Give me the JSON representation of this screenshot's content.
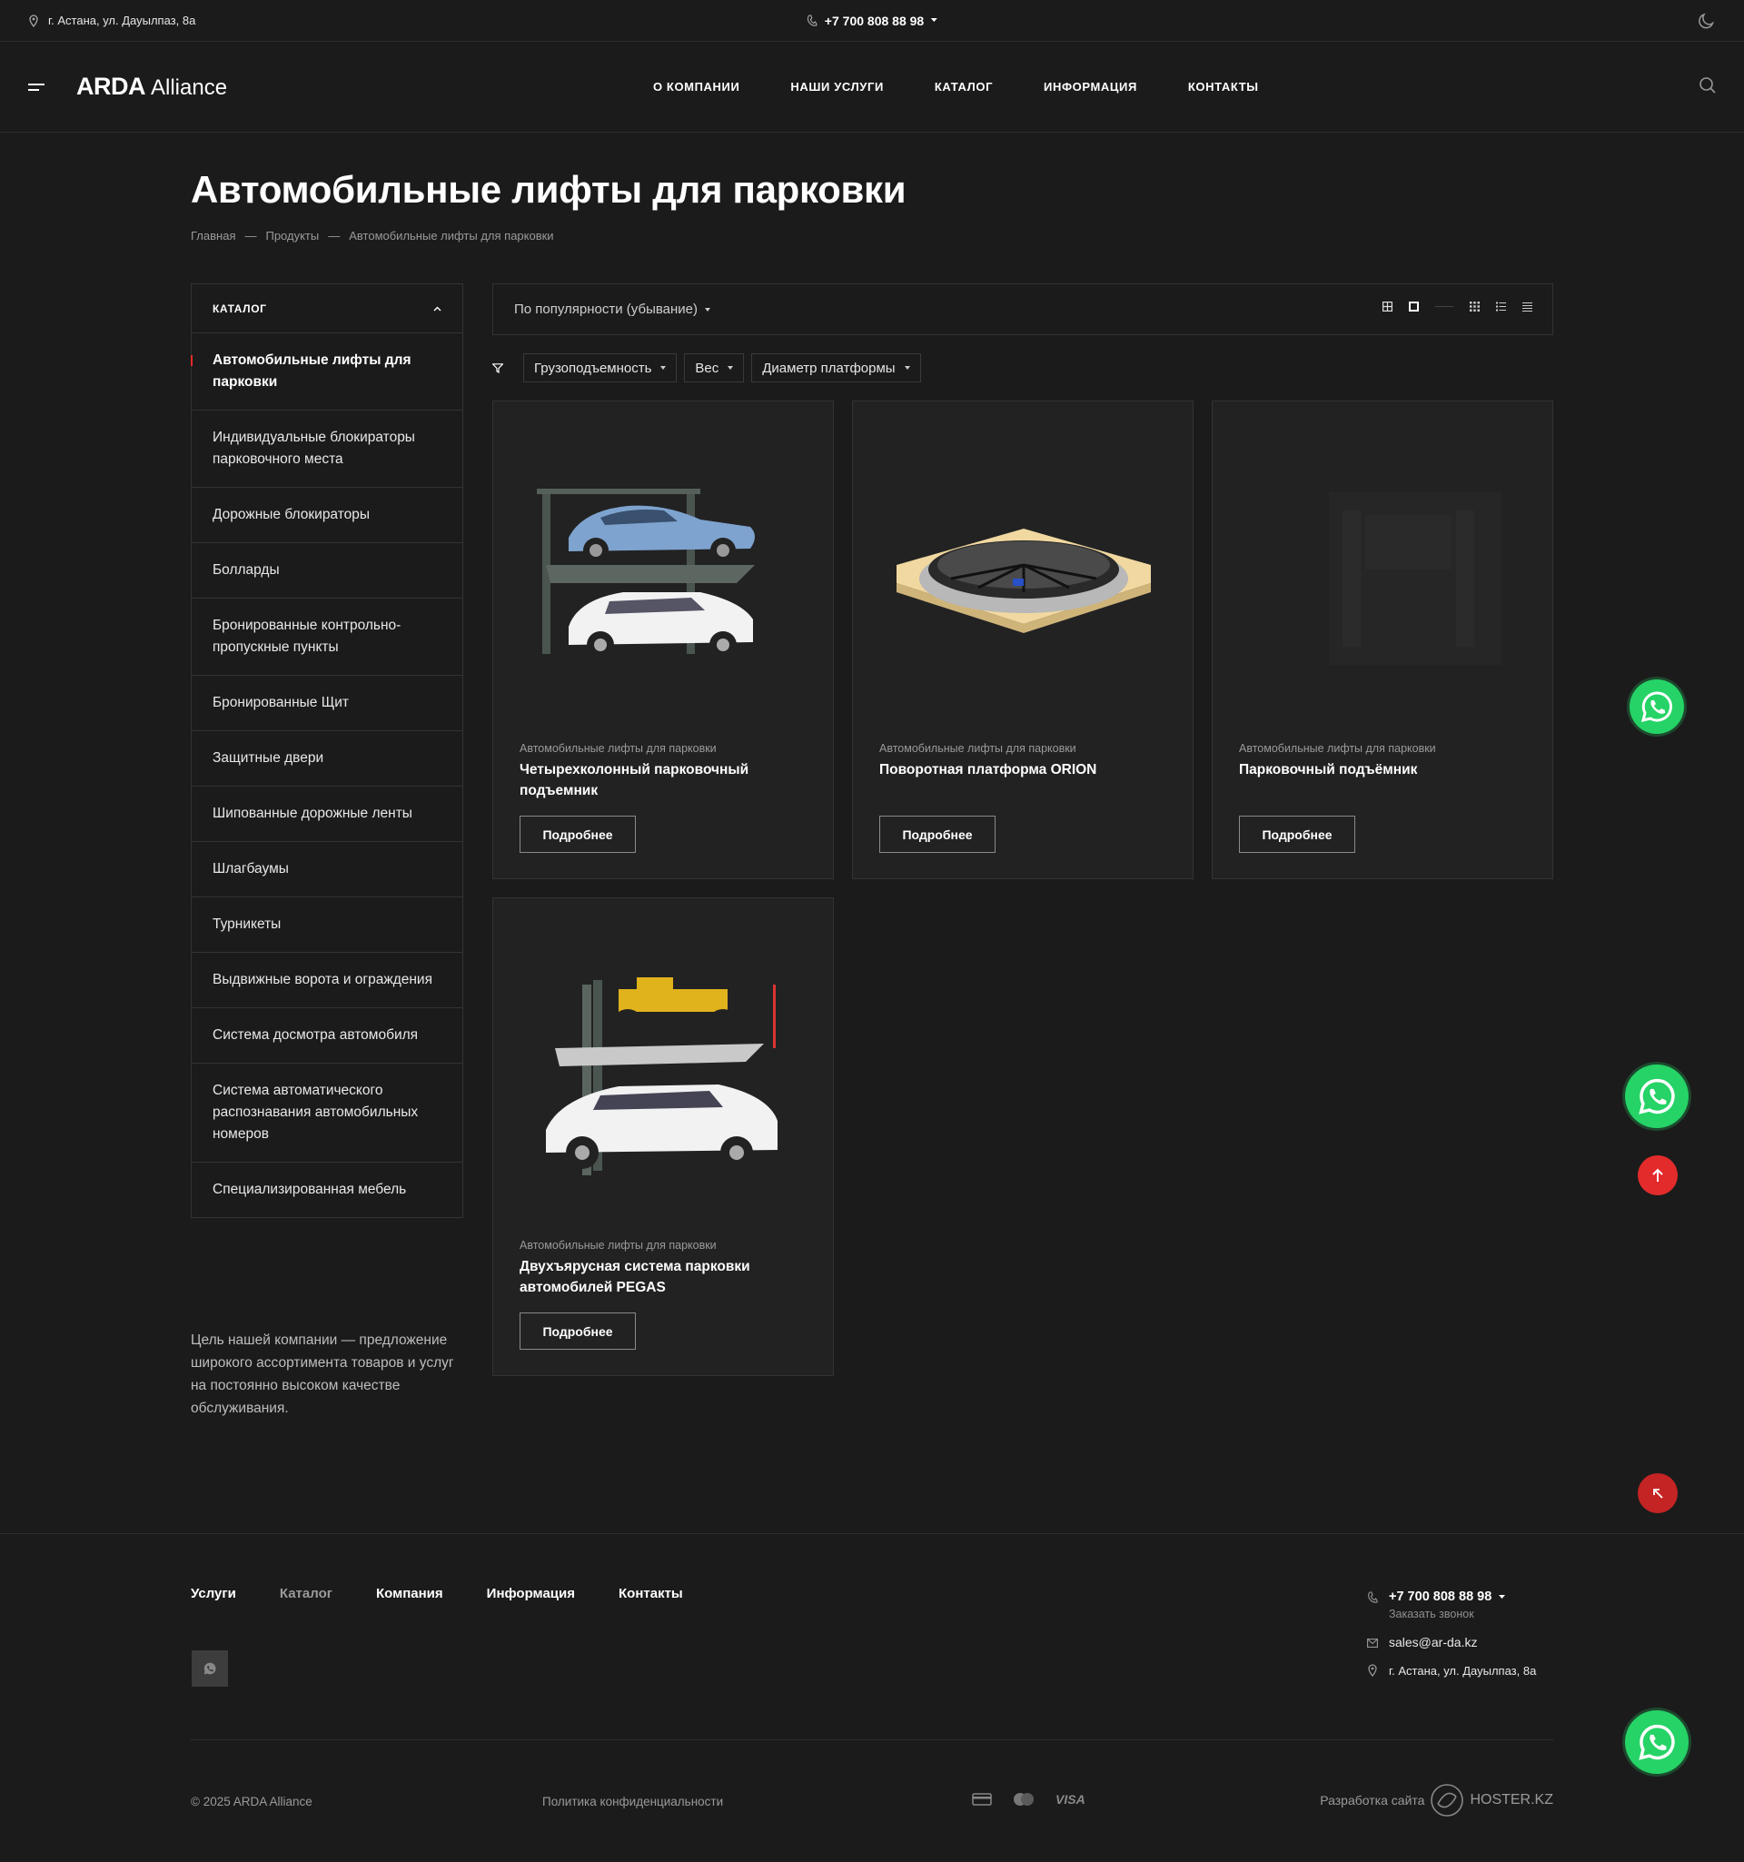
{
  "topbar": {
    "address": "г. Астана, ул. Дауылпаз, 8а",
    "phone": "+7 700 808 88 98"
  },
  "header": {
    "logo_bold": "ARDA",
    "logo_light": "Alliance",
    "nav": [
      "О КОМПАНИИ",
      "НАШИ УСЛУГИ",
      "КАТАЛОГ",
      "ИНФОРМАЦИЯ",
      "КОНТАКТЫ"
    ]
  },
  "page": {
    "title": "Автомобильные лифты для парковки",
    "breadcrumbs": [
      "Главная",
      "Продукты",
      "Автомобильные лифты для парковки"
    ],
    "breadcrumb_sep": "—"
  },
  "sidebar": {
    "header": "КАТАЛОГ",
    "items": [
      "Автомобильные лифты для парковки",
      "Индивидуальные блокираторы парковочного места",
      "Дорожные блокираторы",
      "Болларды",
      "Бронированные контрольно-пропускные пункты",
      "Бронированные Щит",
      "Защитные двери",
      "Шипованные дорожные ленты",
      "Шлагбаумы",
      "Турникеты",
      "Выдвижные ворота и ограждения",
      "Система досмотра автомобиля",
      "Система автоматического распознавания автомобильных номеров",
      "Специализированная мебель"
    ],
    "active_index": 0,
    "description": "Цель нашей компании — предложение широкого ассортимента товаров и услуг на постоянно высоком качестве обслуживания."
  },
  "toolbar": {
    "sort_label": "По популярности (убывание)",
    "view_icons": [
      "grid-large-icon",
      "grid-icon",
      "grid-small-icon",
      "list-icon",
      "compact-list-icon"
    ]
  },
  "filters": [
    "Грузоподъемность",
    "Вес",
    "Диаметр платформы"
  ],
  "products": [
    {
      "category": "Автомобильные лифты для парковки",
      "name": "Четырехколонный парковочный подъемник",
      "button": "Подробнее"
    },
    {
      "category": "Автомобильные лифты для парковки",
      "name": "Поворотная платформа ORION",
      "button": "Подробнее"
    },
    {
      "category": "Автомобильные лифты для парковки",
      "name": "Парковочный подъёмник",
      "button": "Подробнее"
    },
    {
      "category": "Автомобильные лифты для парковки",
      "name": "Двухъярусная система парковки автомобилей PEGAS",
      "button": "Подробнее"
    }
  ],
  "footer": {
    "nav": [
      "Услуги",
      "Каталог",
      "Компания",
      "Информация",
      "Контакты"
    ],
    "phone": "+7 700 808 88 98",
    "callback": "Заказать звонок",
    "email": "sales@ar-da.kz",
    "address": "г. Астана, ул. Дауылпаз, 8а",
    "copyright": "© 2025 ARDA Alliance",
    "policy": "Политика конфиденциальности",
    "payment_visa": "VISA",
    "dev_label": "Разработка сайта",
    "dev_name": "HOSTER.KZ"
  },
  "colors": {
    "background": "#1b1b1b",
    "card": "#222222",
    "accent_red": "#e32b2b",
    "whatsapp": "#25d366"
  }
}
